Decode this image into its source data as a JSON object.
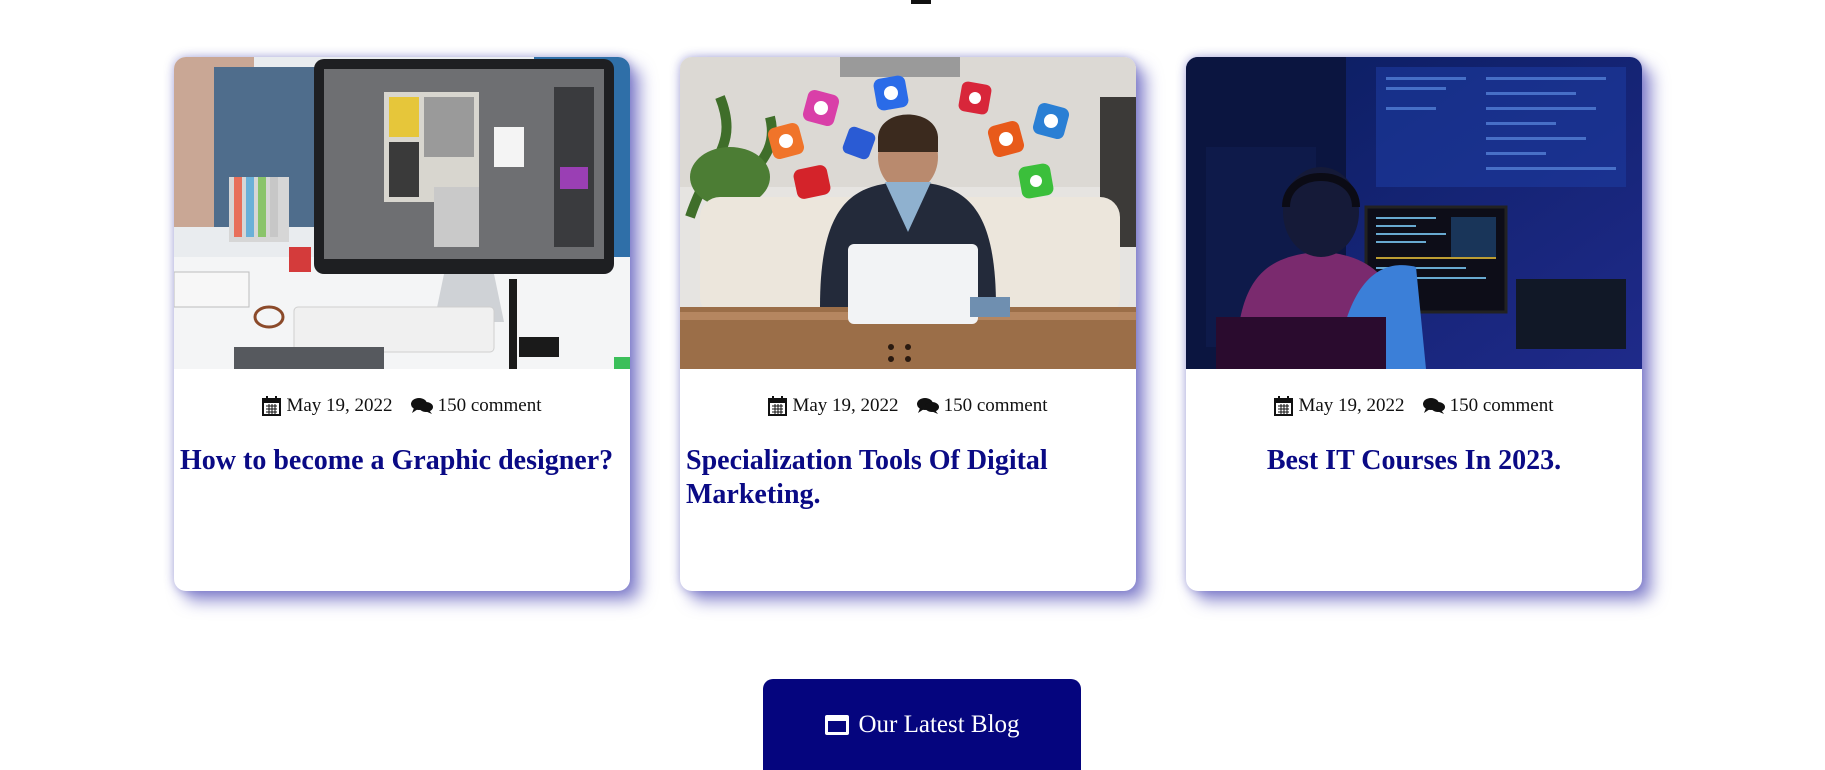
{
  "colors": {
    "accent": "#05057e",
    "title": "#0a0a85",
    "shadow": "#5a57c2"
  },
  "posts": [
    {
      "date": "May 19, 2022",
      "comments": "150 comment",
      "title": "How to become a Graphic designer?",
      "image": "designer-desk-photo"
    },
    {
      "date": "May 19, 2022",
      "comments": "150 comment",
      "title": "Specialization Tools Of Digital Marketing.",
      "image": "digital-marketing-photo"
    },
    {
      "date": "May 19, 2022",
      "comments": "150 comment",
      "title": "Best IT Courses In 2023.",
      "image": "programmer-night-photo"
    }
  ],
  "cta": {
    "label": "Our Latest Blog",
    "icon": "window-icon"
  }
}
